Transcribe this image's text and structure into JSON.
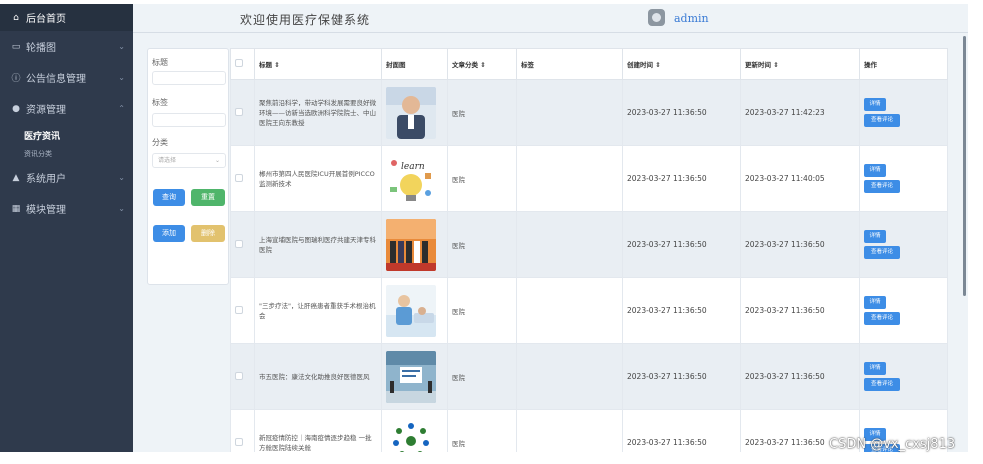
{
  "sidebar": {
    "home": "后台首页",
    "items": [
      {
        "label": "轮播图",
        "icon": "image-icon"
      },
      {
        "label": "公告信息管理",
        "icon": "info-circle-icon"
      },
      {
        "label": "资源管理",
        "icon": "location-pin-icon"
      },
      {
        "label": "系统用户",
        "icon": "user-icon"
      },
      {
        "label": "模块管理",
        "icon": "grid-icon"
      }
    ],
    "sub_active": "医疗资讯",
    "sub_other": "资讯分类"
  },
  "header": {
    "welcome": "欢迎使用医疗保健系统",
    "username": "admin"
  },
  "filter": {
    "title_label": "标题",
    "tags_label": "标签",
    "category_label": "分类",
    "category_placeholder": "请选择",
    "search_button": "查询",
    "reset_button": "重置",
    "add_button": "添加",
    "delete_button": "删除"
  },
  "table": {
    "headers": {
      "title": "标题 ⇕",
      "cover": "封面图",
      "category": "文章分类 ⇕",
      "tags": "标签",
      "created": "创建时间 ⇕",
      "updated": "更新时间 ⇕",
      "actions": "操作"
    },
    "rows": [
      {
        "title": "聚焦前沿科学，带动学科发展需要良好微环境——访新当选欧洲科学院院士、中山医院王向东教授",
        "category": "医院",
        "tags": "",
        "created": "2023-03-27 11:36:50",
        "updated": "2023-03-27 11:42:23"
      },
      {
        "title": "郴州市第四人民医院ICU开展首例PICCO监测新技术",
        "category": "医院",
        "tags": "",
        "created": "2023-03-27 11:36:50",
        "updated": "2023-03-27 11:40:05"
      },
      {
        "title": "上海宣埔医院与图瑞利医疗共建天津专科医院",
        "category": "医院",
        "tags": "",
        "created": "2023-03-27 11:36:50",
        "updated": "2023-03-27 11:36:50"
      },
      {
        "title": "\"三步疗法\"，让肝癌患者重获手术根治机会",
        "category": "医院",
        "tags": "",
        "created": "2023-03-27 11:36:50",
        "updated": "2023-03-27 11:36:50"
      },
      {
        "title": "市五医院：康法文化助推良好医德医风",
        "category": "医院",
        "tags": "",
        "created": "2023-03-27 11:36:50",
        "updated": "2023-03-27 11:36:50"
      },
      {
        "title": "新冠疫情防控｜海南疫情逐步趋稳 一批方舱医院陆续关舱",
        "category": "医院",
        "tags": "",
        "created": "2023-03-27 11:36:50",
        "updated": "2023-03-27 11:36:50"
      }
    ],
    "detail_button": "详情",
    "review_button": "查看评论"
  },
  "watermark": "CSDN @vx_cxsj813"
}
